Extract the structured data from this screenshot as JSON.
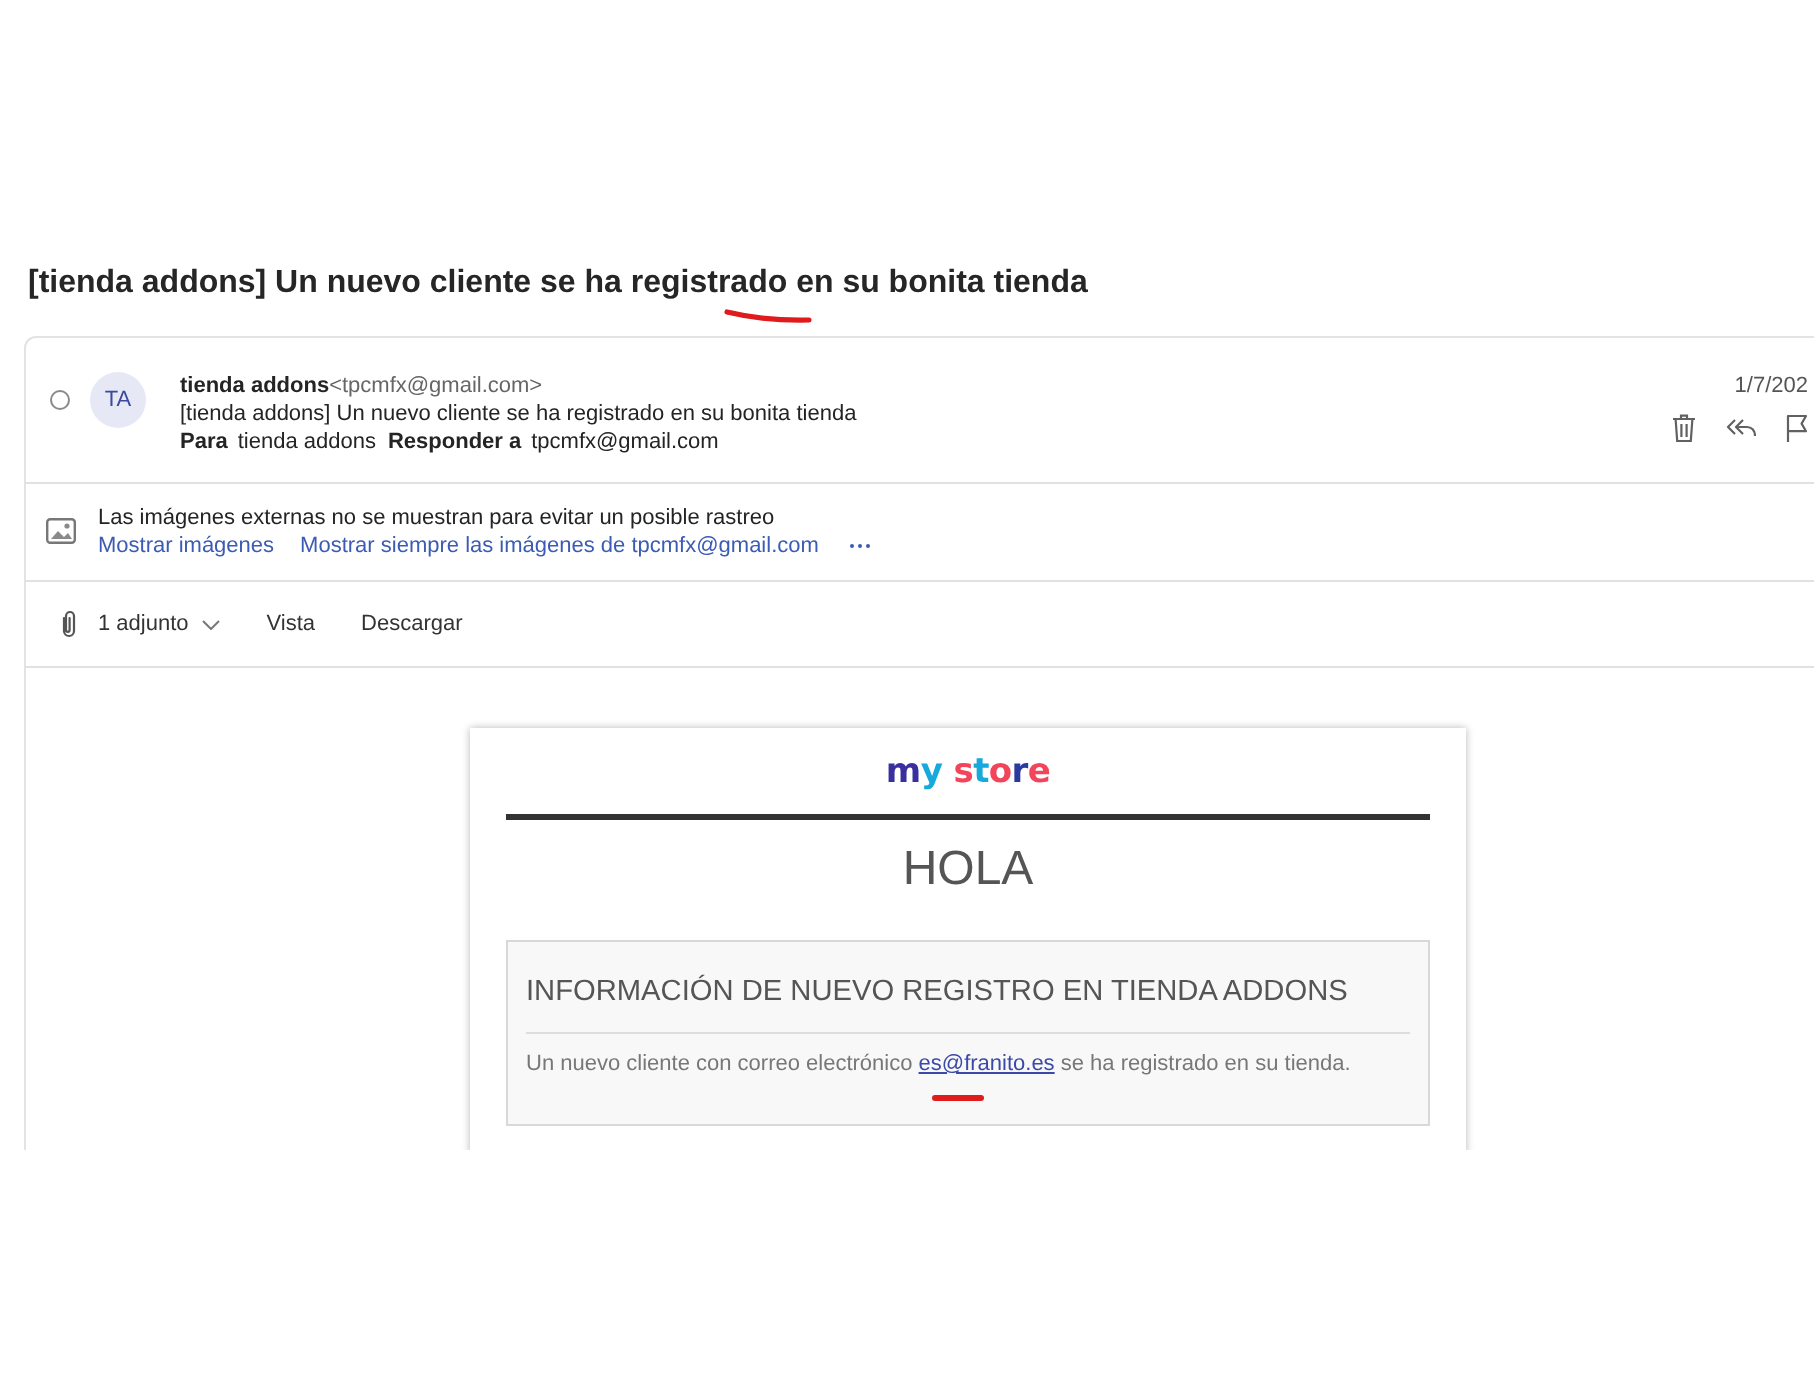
{
  "subject": "[tienda addons] Un nuevo cliente se ha registrado en su bonita tienda",
  "message": {
    "selected": false,
    "avatar_initials": "TA",
    "sender_name": "tienda addons",
    "sender_email": "<tpcmfx@gmail.com>",
    "subject_line": "[tienda addons] Un nuevo cliente se ha registrado en su bonita tienda",
    "recipients": [
      {
        "label": "Para",
        "value": "tienda addons"
      },
      {
        "label": "Responder a",
        "value": "tpcmfx@gmail.com"
      }
    ],
    "date": "1/7/202"
  },
  "image_notice": {
    "text": "Las imágenes externas no se muestran para evitar un posible rastreo",
    "links": [
      "Mostrar imágenes",
      "Mostrar siempre las imágenes de tpcmfx@gmail.com"
    ]
  },
  "attachments": {
    "count_label": "1 adjunto",
    "actions": [
      "Vista",
      "Descargar"
    ]
  },
  "email_body": {
    "logo": "my store",
    "greeting": "HOLA",
    "info_box": {
      "heading": "INFORMACIÓN DE NUEVO REGISTRO EN TIENDA ADDONS",
      "text_before": "Un nuevo cliente con correo electrónico",
      "link": "es@franito.es",
      "text_after": "se ha registrado en su tienda."
    }
  }
}
